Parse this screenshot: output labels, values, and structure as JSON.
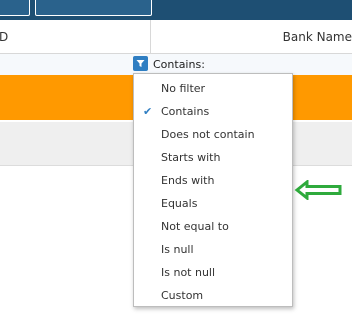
{
  "grid": {
    "columns": [
      {
        "label": "D"
      },
      {
        "label": "Bank Name"
      }
    ],
    "filter_label": "Contains:"
  },
  "filter_menu": {
    "selected": "Contains",
    "items": [
      {
        "label": "No filter",
        "checked": false
      },
      {
        "label": "Contains",
        "checked": true
      },
      {
        "label": "Does not contain",
        "checked": false
      },
      {
        "label": "Starts with",
        "checked": false
      },
      {
        "label": "Ends with",
        "checked": false
      },
      {
        "label": "Equals",
        "checked": false
      },
      {
        "label": "Not equal to",
        "checked": false
      },
      {
        "label": "Is null",
        "checked": false
      },
      {
        "label": "Is not null",
        "checked": false
      },
      {
        "label": "Custom",
        "checked": false
      }
    ]
  },
  "colors": {
    "toolbar": "#1e4f73",
    "accent": "#2f7ec2",
    "selected_row": "#ff9900",
    "annotation_arrow": "#2eaa3c"
  },
  "icons": {
    "filter": "funnel-icon",
    "check": "check-icon",
    "annotation": "left-arrow-icon"
  }
}
